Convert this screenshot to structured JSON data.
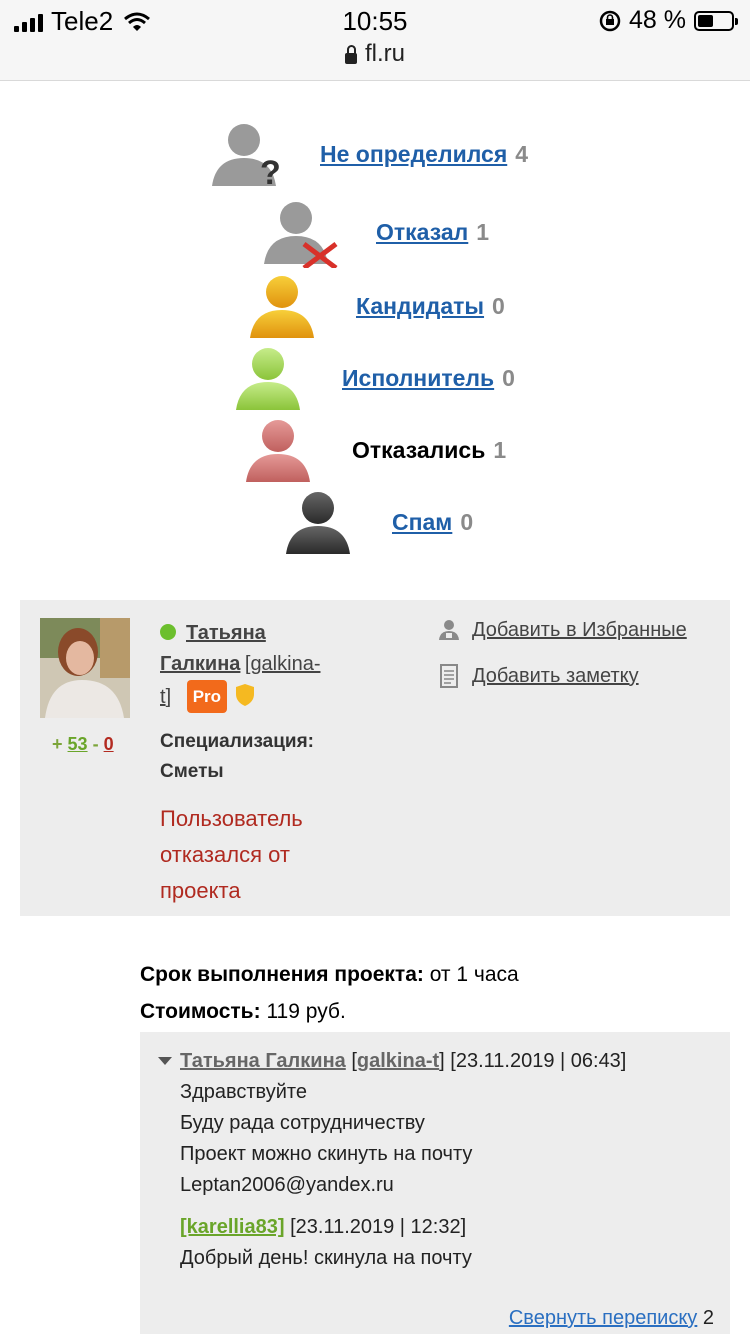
{
  "status_bar": {
    "carrier": "Tele2",
    "time": "10:55",
    "battery": "48 %",
    "battery_level": 0.48,
    "url": "fl.ru"
  },
  "statuses": [
    {
      "label": "Не определился",
      "count": "4",
      "icon": "user-question-icon",
      "link": true
    },
    {
      "label": "Отказал",
      "count": "1",
      "icon": "user-rejected-icon",
      "link": true
    },
    {
      "label": "Кандидаты",
      "count": "0",
      "icon": "user-candidate-icon",
      "link": true
    },
    {
      "label": "Исполнитель",
      "count": "0",
      "icon": "user-executor-icon",
      "link": true
    },
    {
      "label": "Отказались",
      "count": "1",
      "icon": "user-refused-icon",
      "link": false
    },
    {
      "label": "Спам",
      "count": "0",
      "icon": "user-spam-icon",
      "link": true
    }
  ],
  "card": {
    "rating_plus": "+",
    "rating_pos": "53",
    "rating_sep": "-",
    "rating_neg": "0",
    "name_line1": "Татьяна",
    "name_line2": "Галкина",
    "login_open": "[",
    "login_part1": "galkina-",
    "login_part2": "t",
    "login_close": "]",
    "pro_badge": "Pro",
    "spec_label": "Специализация:",
    "spec_value": "Сметы",
    "refused_text": "Пользователь отказался от проекта",
    "add_favorite": "Добавить в Избранные",
    "add_note": "Добавить заметку"
  },
  "project": {
    "deadline_label": "Срок выполнения проекта:",
    "deadline_value": "от 1 часа",
    "cost_label": "Стоимость:",
    "cost_value": "119 руб."
  },
  "conversation": {
    "message1": {
      "author": "Татьяна Галкина",
      "login_open": "[",
      "login": "galkina-t",
      "login_close": "]",
      "timestamp": "[23.11.2019 | 06:43]",
      "lines": [
        "Здравствуйте",
        "Буду рада сотрудничеству",
        "Проект можно скинуть на почту",
        "Leptan2006@yandex.ru"
      ]
    },
    "message2": {
      "login": "[karellia83]",
      "timestamp": "[23.11.2019 | 12:32]",
      "text": "Добрый день! скинула на почту"
    },
    "collapse_label": "Свернуть переписку",
    "collapse_count": "2"
  }
}
